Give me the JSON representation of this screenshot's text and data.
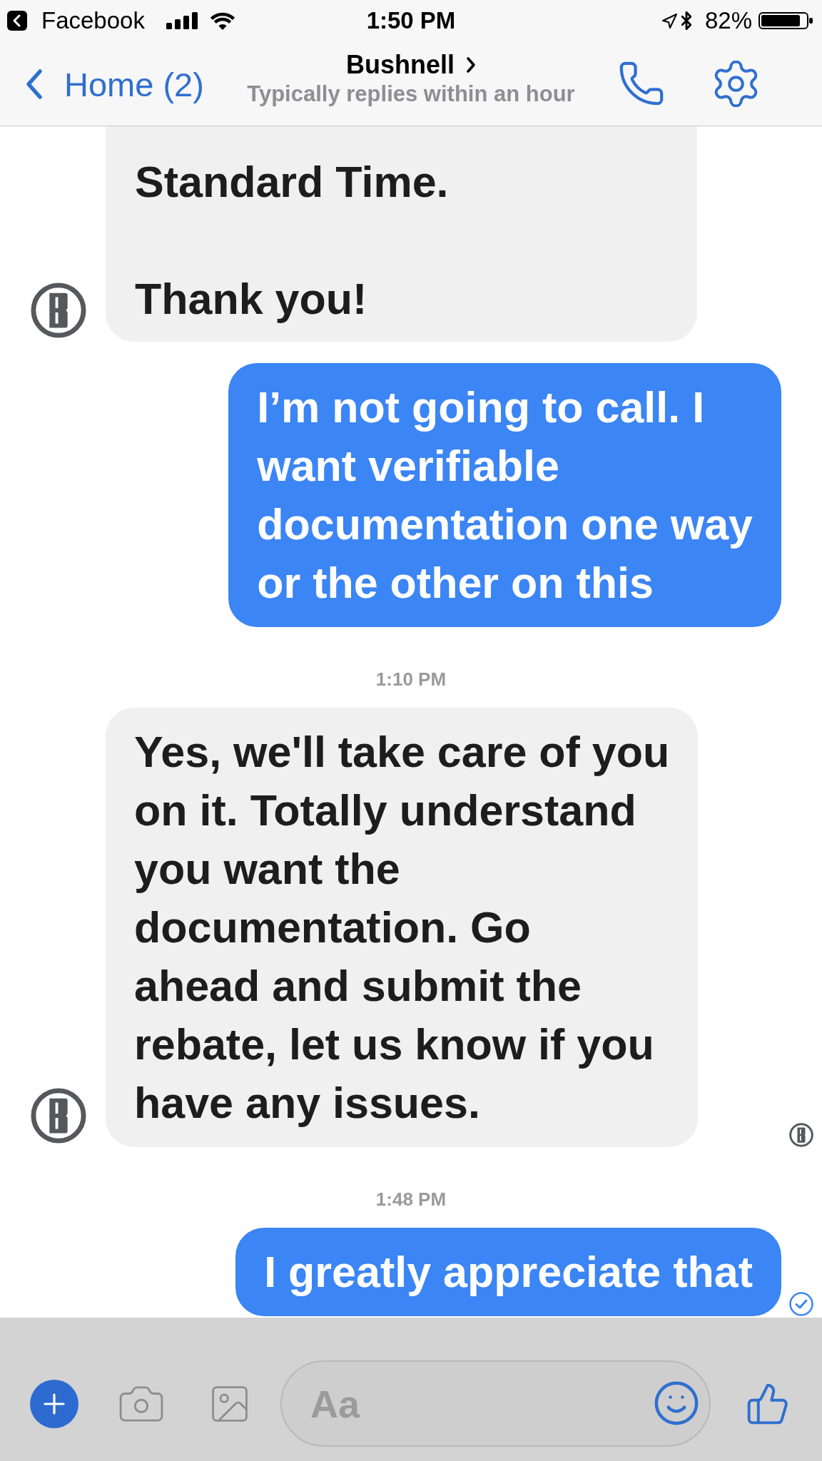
{
  "status_bar": {
    "back_app": "Facebook",
    "time": "1:50 PM",
    "battery": "82%"
  },
  "header": {
    "back_label": "Home (2)",
    "contact": "Bushnell",
    "subtitle": "Typically replies within an hour"
  },
  "messages": [
    {
      "kind": "incoming",
      "text": "Standard Time.\n\nThank you!",
      "seen": false,
      "delivered": false
    },
    {
      "kind": "outgoing",
      "text": "I’m not going to call. I\nwant verifiable\ndocumentation one way\nor the other on this",
      "seen": false,
      "delivered": false
    },
    {
      "kind": "timestamp",
      "text": "1:10 PM"
    },
    {
      "kind": "incoming",
      "text": "Yes, we'll take care of you\non it. Totally understand\nyou want the\ndocumentation. Go\nahead and submit the\nrebate, let us know if you\nhave any issues.",
      "seen": true,
      "delivered": false
    },
    {
      "kind": "timestamp",
      "text": "1:48 PM"
    },
    {
      "kind": "outgoing",
      "text": "I greatly appreciate that",
      "seen": false,
      "delivered": true
    }
  ],
  "composer": {
    "placeholder": "Aa"
  }
}
